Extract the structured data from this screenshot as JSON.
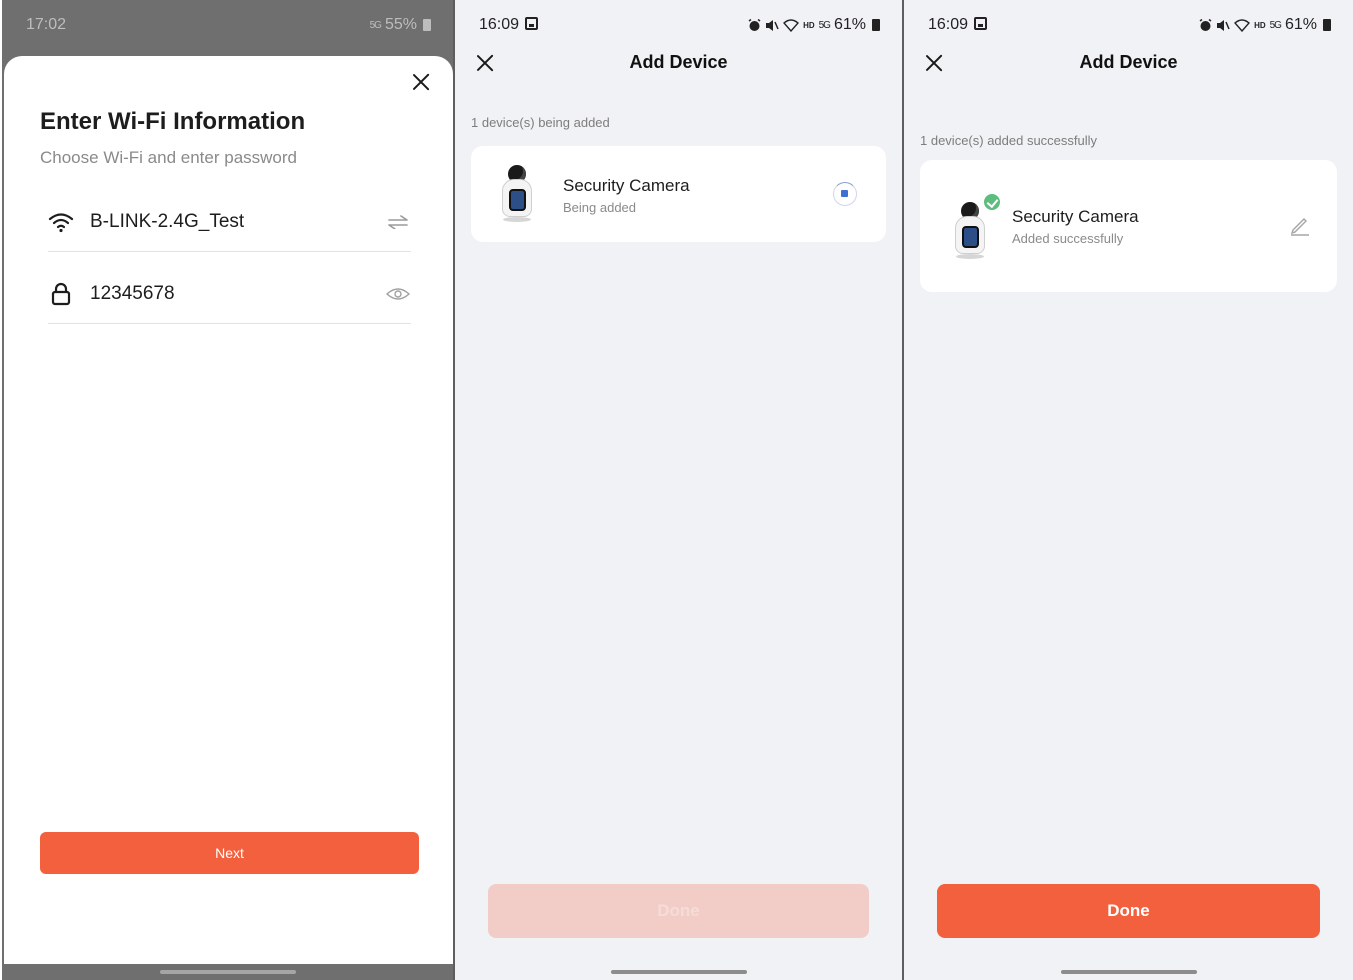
{
  "screen1": {
    "status_time": "17:02",
    "status_signal": "5G",
    "status_battery": "55%",
    "title": "Enter Wi-Fi Information",
    "subtitle": "Choose Wi-Fi and enter password",
    "wifi_ssid": "B-LINK-2.4G_Test",
    "password": "12345678",
    "next_label": "Next"
  },
  "screen2": {
    "status_time": "16:09",
    "status_signal": "5G",
    "status_hd": "HD",
    "status_battery": "61%",
    "title": "Add Device",
    "count_text": "1 device(s) being added",
    "device_name": "Security Camera",
    "device_status": "Being added",
    "done_label": "Done"
  },
  "screen3": {
    "status_time": "16:09",
    "status_signal": "5G",
    "status_hd": "HD",
    "status_battery": "61%",
    "title": "Add Device",
    "count_text": "1 device(s) added successfully",
    "device_name": "Security Camera",
    "device_status": "Added successfully",
    "done_label": "Done"
  },
  "colors": {
    "accent": "#f3603e",
    "accent_disabled": "#f2cdc7",
    "success": "#5cbd7e",
    "page_bg": "#f1f2f5"
  },
  "icons": [
    "close-icon",
    "wifi-icon",
    "switch-network-icon",
    "lock-icon",
    "eye-icon",
    "loading-spinner-icon",
    "check-badge-icon",
    "edit-pencil-icon",
    "picture-icon",
    "alarm-icon",
    "mute-icon",
    "battery-icon"
  ]
}
